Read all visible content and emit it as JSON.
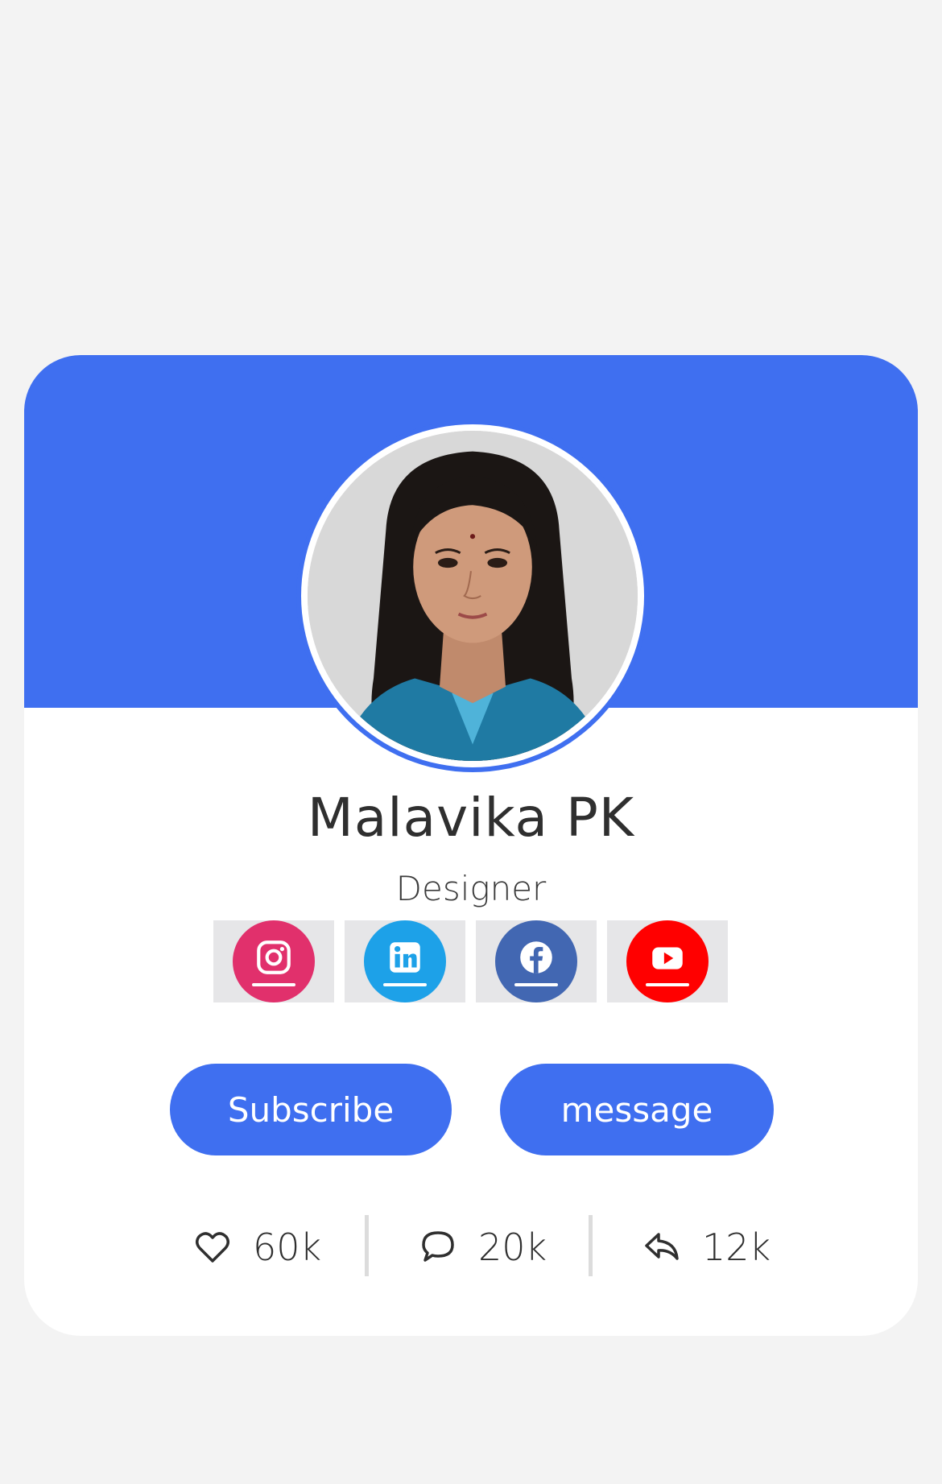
{
  "profile": {
    "name": "Malavika PK",
    "role": "Designer"
  },
  "colors": {
    "accent": "#3f6ff0",
    "background": "#f3f3f3",
    "instagram": "#e1306c",
    "linkedin": "#1da1e8",
    "facebook": "#4267b2",
    "youtube": "#ff0000"
  },
  "socials": [
    {
      "icon": "instagram-icon",
      "color": "#e1306c"
    },
    {
      "icon": "linkedin-icon",
      "color": "#1da1e8"
    },
    {
      "icon": "facebook-icon",
      "color": "#4267b2"
    },
    {
      "icon": "youtube-icon",
      "color": "#ff0000"
    }
  ],
  "actions": {
    "subscribe_label": "Subscribe",
    "message_label": "message"
  },
  "stats": {
    "likes": "60k",
    "comments": "20k",
    "shares": "12k"
  }
}
